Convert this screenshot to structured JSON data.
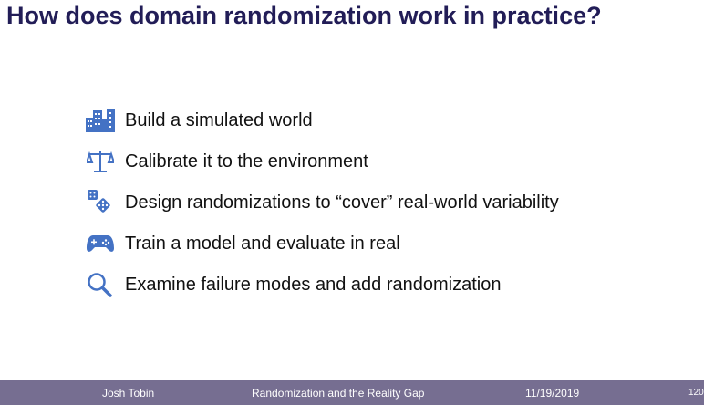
{
  "title": "How does domain randomization work in practice?",
  "icon_color": "#4472c4",
  "items": [
    {
      "icon": "buildings-icon",
      "label": "Build a simulated world"
    },
    {
      "icon": "scales-icon",
      "label": "Calibrate it to the environment"
    },
    {
      "icon": "dice-icon",
      "label": "Design randomizations to “cover” real-world variability"
    },
    {
      "icon": "gamepad-icon",
      "label": "Train a model and evaluate in real"
    },
    {
      "icon": "magnifier-icon",
      "label": "Examine failure modes and add randomization"
    }
  ],
  "footer": {
    "author": "Josh Tobin",
    "talk": "Randomization and the Reality Gap",
    "date": "11/19/2019",
    "page": "120"
  }
}
